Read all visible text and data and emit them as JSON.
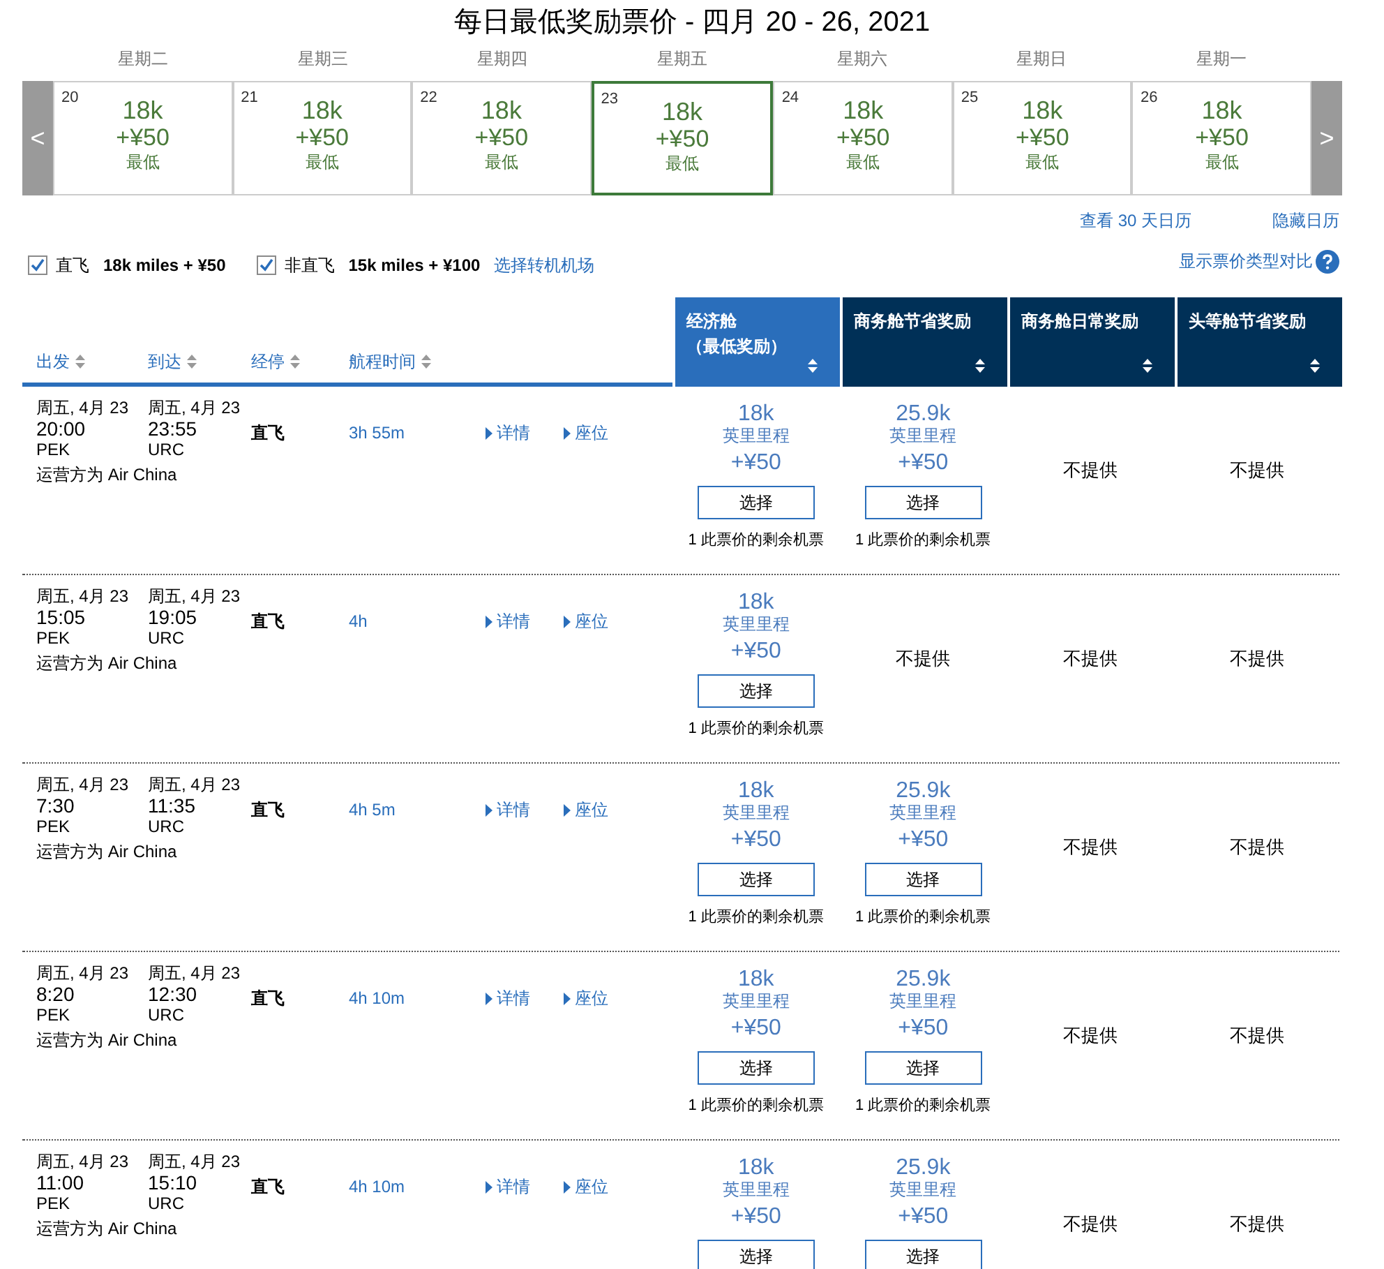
{
  "title": "每日最低奖励票价 - 四月 20 - 26, 2021",
  "calendar": {
    "prev": "<",
    "next": ">",
    "days": [
      {
        "weekday": "星期二",
        "date": "20",
        "miles": "18k",
        "fee": "+¥50",
        "note": "最低",
        "selected": false
      },
      {
        "weekday": "星期三",
        "date": "21",
        "miles": "18k",
        "fee": "+¥50",
        "note": "最低",
        "selected": false
      },
      {
        "weekday": "星期四",
        "date": "22",
        "miles": "18k",
        "fee": "+¥50",
        "note": "最低",
        "selected": false
      },
      {
        "weekday": "星期五",
        "date": "23",
        "miles": "18k",
        "fee": "+¥50",
        "note": "最低",
        "selected": true
      },
      {
        "weekday": "星期六",
        "date": "24",
        "miles": "18k",
        "fee": "+¥50",
        "note": "最低",
        "selected": false
      },
      {
        "weekday": "星期日",
        "date": "25",
        "miles": "18k",
        "fee": "+¥50",
        "note": "最低",
        "selected": false
      },
      {
        "weekday": "星期一",
        "date": "26",
        "miles": "18k",
        "fee": "+¥50",
        "note": "最低",
        "selected": false
      }
    ]
  },
  "calendar_links": [
    "查看 30 天日历",
    "隐藏日历"
  ],
  "filters": [
    {
      "label": "直飞",
      "price": "18k miles + ¥50",
      "checked": true
    },
    {
      "label": "非直飞",
      "price": "15k miles + ¥100",
      "checked": true
    }
  ],
  "connection_link": "选择转机机场",
  "compare_link": "显示票价类型对比",
  "columns": [
    "出发",
    "到达",
    "经停",
    "航程时间"
  ],
  "fare_columns": [
    {
      "title": "经济舱",
      "subtitle": "（最低奖励）",
      "selected": true
    },
    {
      "title": "商务舱节省奖励",
      "selected": false
    },
    {
      "title": "商务舱日常奖励",
      "selected": false
    },
    {
      "title": "头等舱节省奖励",
      "selected": false
    }
  ],
  "rows": [
    {
      "depart_date": "周五, 4月 23",
      "depart_time": "20:00",
      "depart_airport": "PEK",
      "arrive_date": "周五, 4月 23",
      "arrive_time": "23:55",
      "arrive_airport": "URC",
      "operator": "运营方为 Air China",
      "stops": "直飞",
      "duration": "3h 55m",
      "details": "详情",
      "seats": "座位",
      "fares": [
        {
          "kind": "offer",
          "miles": "18k",
          "unit": "英里里程",
          "fee": "+¥50",
          "button": "选择",
          "remaining": "1 此票价的剩余机票"
        },
        {
          "kind": "offer",
          "miles": "25.9k",
          "unit": "英里里程",
          "fee": "+¥50",
          "button": "选择",
          "remaining": "1 此票价的剩余机票"
        },
        {
          "kind": "none",
          "text": "不提供"
        },
        {
          "kind": "none",
          "text": "不提供"
        }
      ]
    },
    {
      "depart_date": "周五, 4月 23",
      "depart_time": "15:05",
      "depart_airport": "PEK",
      "arrive_date": "周五, 4月 23",
      "arrive_time": "19:05",
      "arrive_airport": "URC",
      "operator": "运营方为 Air China",
      "stops": "直飞",
      "duration": "4h",
      "details": "详情",
      "seats": "座位",
      "fares": [
        {
          "kind": "offer",
          "miles": "18k",
          "unit": "英里里程",
          "fee": "+¥50",
          "button": "选择",
          "remaining": "1 此票价的剩余机票"
        },
        {
          "kind": "none",
          "text": "不提供"
        },
        {
          "kind": "none",
          "text": "不提供"
        },
        {
          "kind": "none",
          "text": "不提供"
        }
      ]
    },
    {
      "depart_date": "周五, 4月 23",
      "depart_time": "7:30",
      "depart_airport": "PEK",
      "arrive_date": "周五, 4月 23",
      "arrive_time": "11:35",
      "arrive_airport": "URC",
      "operator": "运营方为 Air China",
      "stops": "直飞",
      "duration": "4h 5m",
      "details": "详情",
      "seats": "座位",
      "fares": [
        {
          "kind": "offer",
          "miles": "18k",
          "unit": "英里里程",
          "fee": "+¥50",
          "button": "选择",
          "remaining": "1 此票价的剩余机票"
        },
        {
          "kind": "offer",
          "miles": "25.9k",
          "unit": "英里里程",
          "fee": "+¥50",
          "button": "选择",
          "remaining": "1 此票价的剩余机票"
        },
        {
          "kind": "none",
          "text": "不提供"
        },
        {
          "kind": "none",
          "text": "不提供"
        }
      ]
    },
    {
      "depart_date": "周五, 4月 23",
      "depart_time": "8:20",
      "depart_airport": "PEK",
      "arrive_date": "周五, 4月 23",
      "arrive_time": "12:30",
      "arrive_airport": "URC",
      "operator": "运营方为 Air China",
      "stops": "直飞",
      "duration": "4h 10m",
      "details": "详情",
      "seats": "座位",
      "fares": [
        {
          "kind": "offer",
          "miles": "18k",
          "unit": "英里里程",
          "fee": "+¥50",
          "button": "选择",
          "remaining": "1 此票价的剩余机票"
        },
        {
          "kind": "offer",
          "miles": "25.9k",
          "unit": "英里里程",
          "fee": "+¥50",
          "button": "选择",
          "remaining": "1 此票价的剩余机票"
        },
        {
          "kind": "none",
          "text": "不提供"
        },
        {
          "kind": "none",
          "text": "不提供"
        }
      ]
    },
    {
      "depart_date": "周五, 4月 23",
      "depart_time": "11:00",
      "depart_airport": "PEK",
      "arrive_date": "周五, 4月 23",
      "arrive_time": "15:10",
      "arrive_airport": "URC",
      "operator": "运营方为 Air China",
      "stops": "直飞",
      "duration": "4h 10m",
      "details": "详情",
      "seats": "座位",
      "fares": [
        {
          "kind": "offer",
          "miles": "18k",
          "unit": "英里里程",
          "fee": "+¥50",
          "button": "选择"
        },
        {
          "kind": "offer",
          "miles": "25.9k",
          "unit": "英里里程",
          "fee": "+¥50",
          "button": "选择"
        },
        {
          "kind": "none",
          "text": "不提供"
        },
        {
          "kind": "none",
          "text": "不提供"
        }
      ]
    }
  ]
}
